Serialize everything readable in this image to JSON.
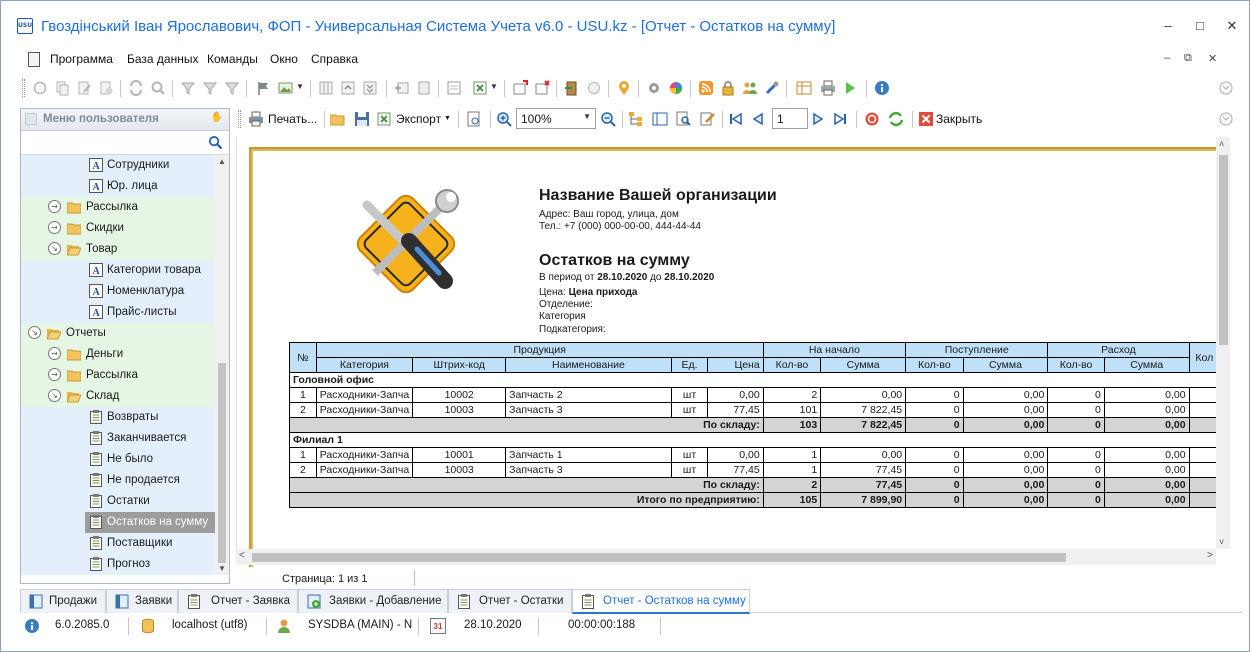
{
  "window": {
    "title": "Гвоздінський Іван Ярославович, ФОП - Универсальная Система Учета v6.0 - USU.kz - [Отчет - Остатков на сумму]",
    "app_icon_text": "USU"
  },
  "menu": {
    "items": [
      "Программа",
      "База данных",
      "Команды",
      "Окно",
      "Справка"
    ]
  },
  "sidebar": {
    "title": "Меню пользователя",
    "items": [
      {
        "label": "Сотрудники"
      },
      {
        "label": "Юр. лица"
      },
      {
        "label": "Рассылка"
      },
      {
        "label": "Скидки"
      },
      {
        "label": "Товар"
      },
      {
        "label": "Категории товара"
      },
      {
        "label": "Номенклатура"
      },
      {
        "label": "Прайс-листы"
      },
      {
        "label": "Отчеты"
      },
      {
        "label": "Деньги"
      },
      {
        "label": "Рассылка"
      },
      {
        "label": "Склад"
      },
      {
        "label": "Возвраты"
      },
      {
        "label": "Заканчивается"
      },
      {
        "label": "Не было"
      },
      {
        "label": "Не продается"
      },
      {
        "label": "Остатки"
      },
      {
        "label": "Остатков на сумму"
      },
      {
        "label": "Поставщики"
      },
      {
        "label": "Прогноз"
      }
    ]
  },
  "report_toolbar": {
    "print_label": "Печать...",
    "export_label": "Экспорт",
    "zoom": "100%",
    "page_number": "1",
    "close_label": "Закрыть"
  },
  "report": {
    "org_name": "Название Вашей организации",
    "address": "Адрес: Ваш город, улица, дом",
    "phone": "Тел.: +7 (000) 000-00-00, 444-44-44",
    "title": "Остатков на сумму",
    "period_prefix": "В период от",
    "date_from": "28.10.2020",
    "period_mid": "до",
    "date_to": "28.10.2020",
    "price_label": "Цена:",
    "price_value": "Цена прихода",
    "department_label": "Отделение:",
    "category_label": "Категория",
    "subcategory_label": "Подкатегория:",
    "headers": {
      "num": "№",
      "product": "Продукция",
      "at_start": "На начало",
      "income": "Поступление",
      "expense": "Расход",
      "next_cut": "Кол",
      "category": "Категория",
      "barcode": "Штрих-код",
      "name": "Наименование",
      "unit": "Ед.",
      "price": "Цена",
      "qty": "Кол-во",
      "sum": "Сумма"
    },
    "groups": [
      {
        "name": "Головной офис",
        "rows": [
          {
            "n": "1",
            "cat": "Расходники-Запча",
            "code": "10002",
            "name": "Запчасть 2",
            "unit": "шт",
            "price": "0,00",
            "q0": "2",
            "s0": "0,00",
            "q1": "0",
            "s1": "0,00",
            "q2": "0",
            "s2": "0,00"
          },
          {
            "n": "2",
            "cat": "Расходники-Запча",
            "code": "10003",
            "name": "Запчасть 3",
            "unit": "шт",
            "price": "77,45",
            "q0": "101",
            "s0": "7 822,45",
            "q1": "0",
            "s1": "0,00",
            "q2": "0",
            "s2": "0,00"
          }
        ],
        "total_label": "По складу:",
        "total": {
          "q0": "103",
          "s0": "7 822,45",
          "q1": "0",
          "s1": "0,00",
          "q2": "0",
          "s2": "0,00"
        }
      },
      {
        "name": "Филиал 1",
        "rows": [
          {
            "n": "1",
            "cat": "Расходники-Запча",
            "code": "10001",
            "name": "Запчасть 1",
            "unit": "шт",
            "price": "0,00",
            "q0": "1",
            "s0": "0,00",
            "q1": "0",
            "s1": "0,00",
            "q2": "0",
            "s2": "0,00"
          },
          {
            "n": "2",
            "cat": "Расходники-Запча",
            "code": "10003",
            "name": "Запчасть 3",
            "unit": "шт",
            "price": "77,45",
            "q0": "1",
            "s0": "77,45",
            "q1": "0",
            "s1": "0,00",
            "q2": "0",
            "s2": "0,00"
          }
        ],
        "total_label": "По складу:",
        "total": {
          "q0": "2",
          "s0": "77,45",
          "q1": "0",
          "s1": "0,00",
          "q2": "0",
          "s2": "0,00"
        }
      }
    ],
    "grand_total_label": "Итого по предприятию:",
    "grand_total": {
      "q0": "105",
      "s0": "7 899,90",
      "q1": "0",
      "s1": "0,00",
      "q2": "0",
      "s2": "0,00"
    }
  },
  "page_info": "Страница: 1 из 1",
  "tabs": [
    {
      "label": "Продажи"
    },
    {
      "label": "Заявки"
    },
    {
      "label": "Отчет - Заявка"
    },
    {
      "label": "Заявки - Добавление"
    },
    {
      "label": "Отчет - Остатки"
    },
    {
      "label": "Отчет - Остатков на сумму"
    }
  ],
  "status": {
    "version": "6.0.2085.0",
    "db": "localhost (utf8)",
    "user": "SYSDBA (MAIN) - N",
    "calendar_day": "31",
    "date": "28.10.2020",
    "timer": "00:00:00:188"
  },
  "colors": {
    "title_blue": "#1e6fd9",
    "header_blue": "#bfe0f7",
    "tree_green": "#e5f6e5",
    "tree_blue": "#e3f0fc",
    "page_border": "#c79a2a"
  }
}
